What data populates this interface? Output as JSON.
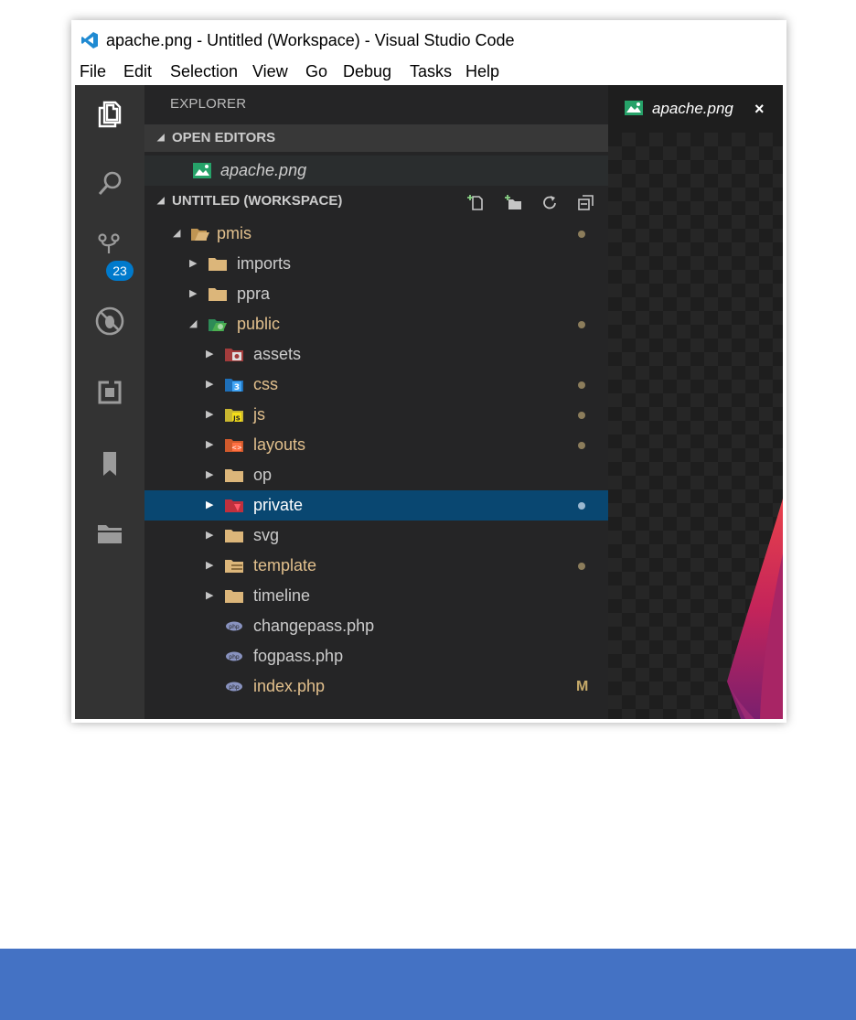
{
  "window": {
    "title": "apache.png - Untitled (Workspace) - Visual Studio Code",
    "logo_icon": "vscode-logo-icon"
  },
  "menu": [
    "File",
    "Edit",
    "Selection",
    "View",
    "Go",
    "Debug",
    "Tasks",
    "Help"
  ],
  "activity_bar": {
    "icons": [
      "explorer-icon",
      "search-icon",
      "source-control-icon",
      "debug-icon",
      "extensions-icon",
      "bookmark-icon",
      "folder-icon"
    ],
    "source_control_badge": "23"
  },
  "explorer": {
    "title": "EXPLORER",
    "open_editors_label": "OPEN EDITORS",
    "open_editor_file": "apache.png",
    "workspace_label": "UNTITLED (WORKSPACE)",
    "workspace_actions": [
      "new-file-icon",
      "new-folder-icon",
      "refresh-icon",
      "collapse-all-icon"
    ],
    "tree": [
      {
        "name": "pmis",
        "expanded": true,
        "modified": true
      },
      {
        "name": "imports",
        "expanded": false,
        "modified": false
      },
      {
        "name": "ppra",
        "expanded": false,
        "modified": false
      },
      {
        "name": "public",
        "expanded": true,
        "modified": true
      },
      {
        "name": "assets",
        "expanded": false,
        "modified": false
      },
      {
        "name": "css",
        "expanded": false,
        "modified": true
      },
      {
        "name": "js",
        "expanded": false,
        "modified": true
      },
      {
        "name": "layouts",
        "expanded": false,
        "modified": true
      },
      {
        "name": "op",
        "expanded": false,
        "modified": false
      },
      {
        "name": "private",
        "expanded": false,
        "modified": true,
        "selected": true
      },
      {
        "name": "svg",
        "expanded": false,
        "modified": false
      },
      {
        "name": "template",
        "expanded": false,
        "modified": true
      },
      {
        "name": "timeline",
        "expanded": false,
        "modified": false
      },
      {
        "name": "changepass.php",
        "modified": false
      },
      {
        "name": "fogpass.php",
        "modified": false
      },
      {
        "name": "index.php",
        "modified": true,
        "status": "M"
      }
    ]
  },
  "editor": {
    "tab_label": "apache.png",
    "tab_close": "×"
  },
  "colors": {
    "activity_bar": "#333333",
    "sidebar": "#252526",
    "selection": "#094771",
    "badge": "#007acc",
    "modified_text": "#e2c08d",
    "bottom_bar": "#4472c4"
  }
}
